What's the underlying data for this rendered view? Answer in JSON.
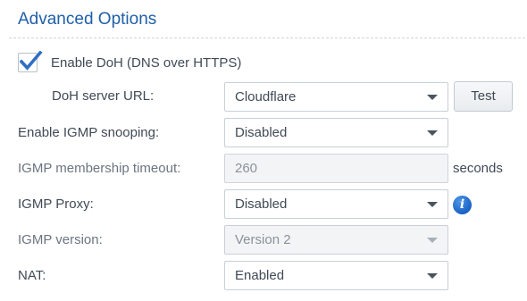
{
  "section": {
    "title": "Advanced Options"
  },
  "doh": {
    "checkbox_label": "Enable DoH (DNS over HTTPS)",
    "checked": true,
    "server_url_label": "DoH server URL:",
    "server_url_value": "Cloudflare",
    "test_button": "Test"
  },
  "igmp_snooping": {
    "label": "Enable IGMP snooping:",
    "value": "Disabled"
  },
  "igmp_timeout": {
    "label": "IGMP membership timeout:",
    "value": "260",
    "unit": "seconds"
  },
  "igmp_proxy": {
    "label": "IGMP Proxy:",
    "value": "Disabled",
    "info_icon": "info-icon"
  },
  "igmp_version": {
    "label": "IGMP version:",
    "value": "Version 2"
  },
  "nat": {
    "label": "NAT:",
    "value": "Enabled"
  },
  "colors": {
    "title": "#1f5fa8",
    "checkmark": "#2f6fc2",
    "info": "#1a62c5"
  }
}
